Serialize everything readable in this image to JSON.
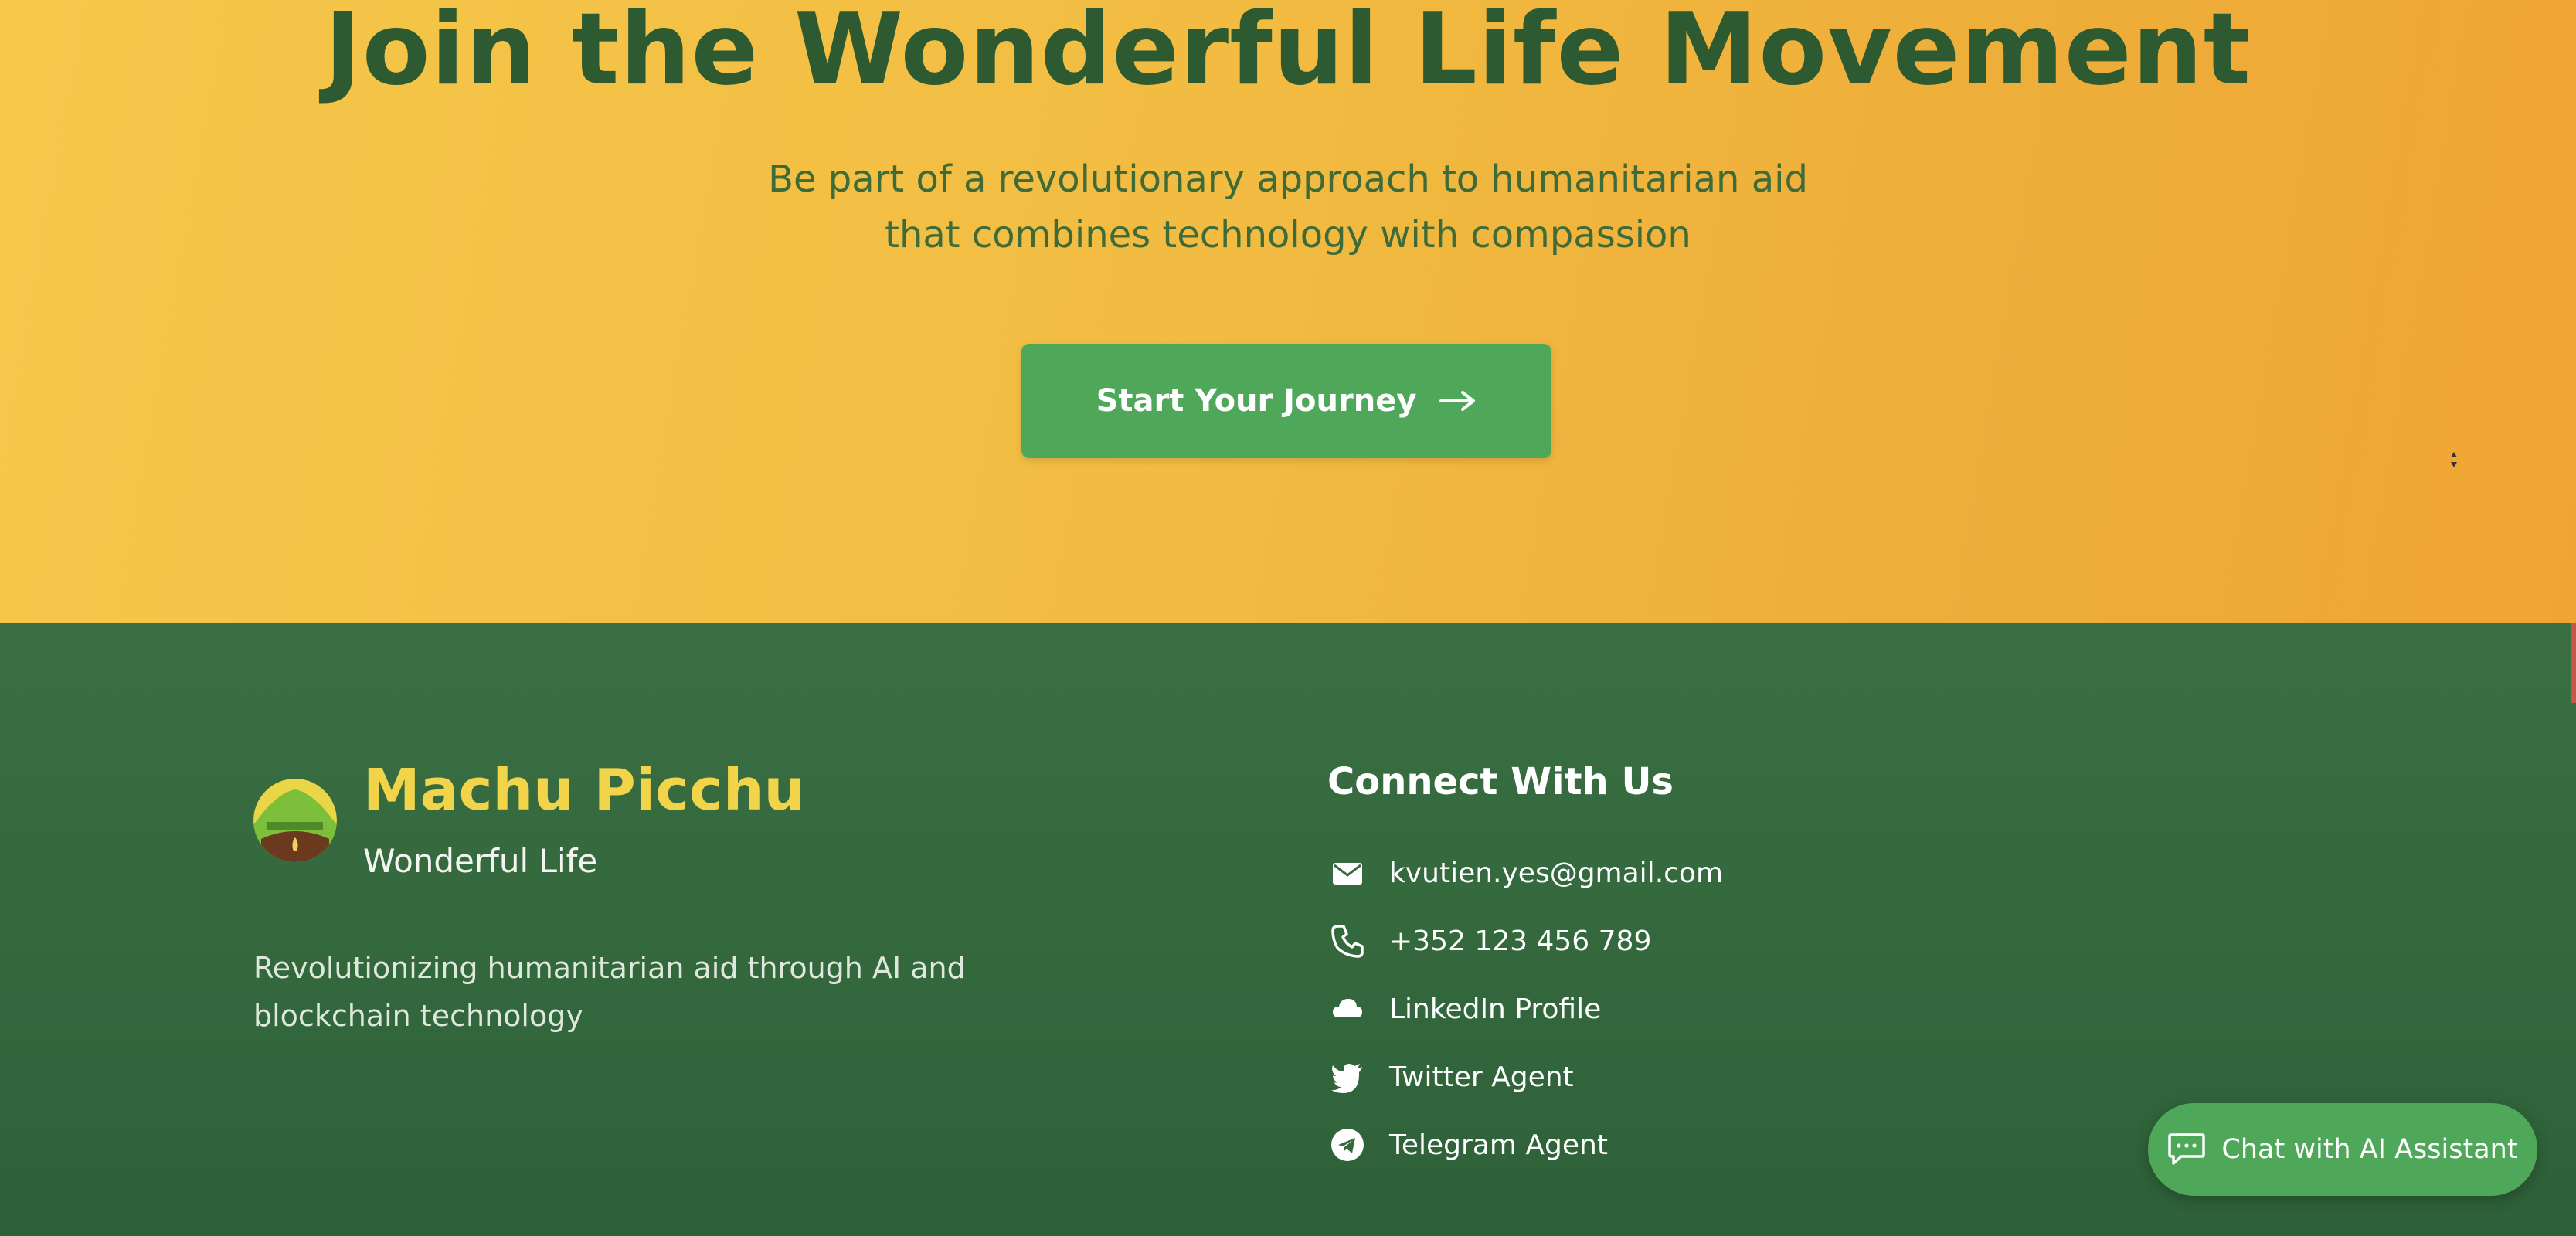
{
  "hero": {
    "title": "Join the Wonderful Life Movement",
    "subtitle_line1": "Be part of a revolutionary approach to humanitarian aid",
    "subtitle_line2": "that combines technology with compassion",
    "cta_label": "Start Your Journey",
    "cta_icon": "arrow-right-icon"
  },
  "footer": {
    "brand": {
      "name": "Machu Picchu",
      "tagline": "Wonderful Life",
      "description_line1": "Revolutionizing humanitarian aid through AI and",
      "description_line2": "blockchain technology",
      "logo_icon": "machu-picchu-logo"
    },
    "connect": {
      "title": "Connect With Us",
      "items": [
        {
          "icon": "mail-icon",
          "label": "kvutien.yes@gmail.com"
        },
        {
          "icon": "phone-icon",
          "label": "+352 123 456 789"
        },
        {
          "icon": "cloud-icon",
          "label": "LinkedIn Profile"
        },
        {
          "icon": "twitter-icon",
          "label": "Twitter Agent"
        },
        {
          "icon": "telegram-icon",
          "label": "Telegram Agent"
        }
      ]
    }
  },
  "chat": {
    "label": "Chat with AI Assistant",
    "icon": "chat-bubble-icon"
  },
  "colors": {
    "hero_bg": "#f2bc42",
    "title": "#2d5a30",
    "accent_green": "#4fa85a",
    "footer_bg": "#356a3e",
    "brand_yellow": "#f1d44a"
  }
}
